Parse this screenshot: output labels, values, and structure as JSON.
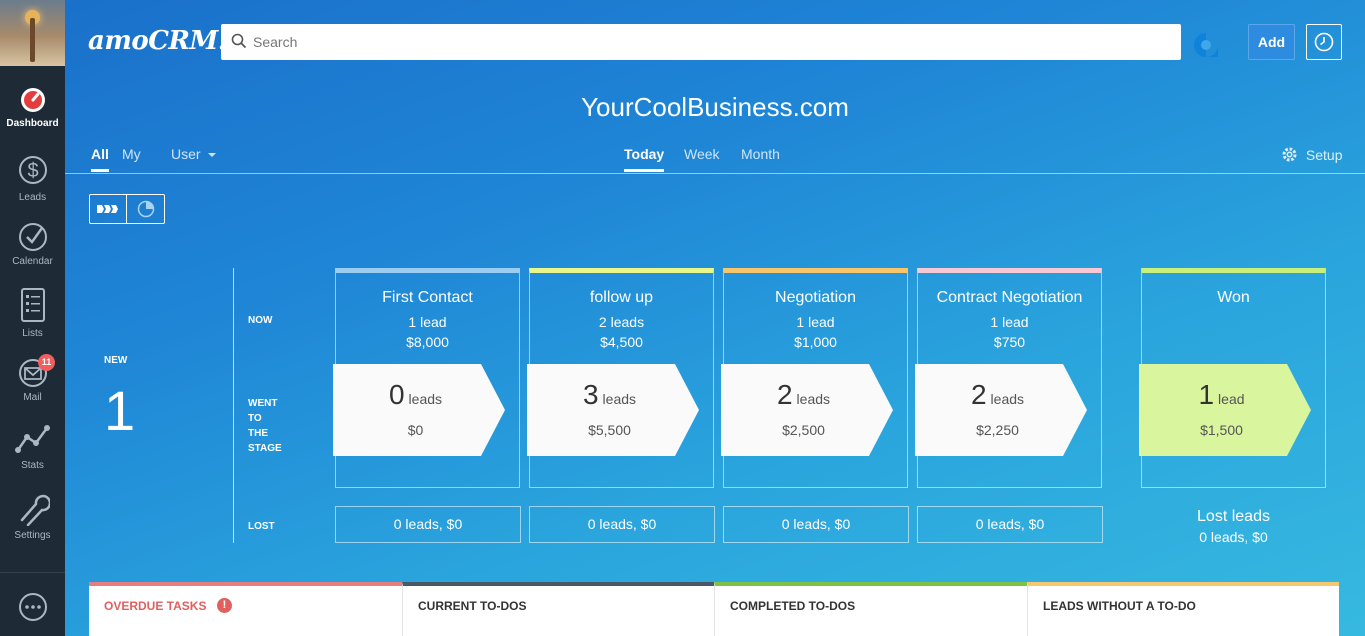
{
  "app": {
    "logo": "amoCRM.",
    "title": "YourCoolBusiness.com"
  },
  "search": {
    "placeholder": "Search"
  },
  "topbar": {
    "add_label": "Add"
  },
  "sidebar": {
    "items": [
      {
        "label": "Dashboard",
        "icon": "dashboard-icon",
        "active": true
      },
      {
        "label": "Leads",
        "icon": "dollar-icon"
      },
      {
        "label": "Calendar",
        "icon": "checkmark-circle-icon"
      },
      {
        "label": "Lists",
        "icon": "list-icon"
      },
      {
        "label": "Mail",
        "icon": "mail-icon",
        "badge": "11"
      },
      {
        "label": "Stats",
        "icon": "stats-icon"
      },
      {
        "label": "Settings",
        "icon": "wrench-icon"
      }
    ]
  },
  "filters": {
    "all": "All",
    "my": "My",
    "user": "User",
    "today": "Today",
    "week": "Week",
    "month": "Month",
    "setup": "Setup"
  },
  "pipeline": {
    "labels": {
      "new": "NEW",
      "now": "NOW",
      "went": "WENT\nTO\nTHE\nSTAGE",
      "lost": "LOST"
    },
    "new_count": "1",
    "stages": [
      {
        "name": "First Contact",
        "now_count": "1 lead",
        "now_amount": "$8,000",
        "went_num": "0",
        "went_unit": "leads",
        "went_amount": "$0",
        "lost": "0 leads, $0",
        "color": "#9bcdf2"
      },
      {
        "name": "follow up",
        "now_count": "2 leads",
        "now_amount": "$4,500",
        "went_num": "3",
        "went_unit": "leads",
        "went_amount": "$5,500",
        "lost": "0 leads, $0",
        "color": "#e9f78a"
      },
      {
        "name": "Negotiation",
        "now_count": "1 lead",
        "now_amount": "$1,000",
        "went_num": "2",
        "went_unit": "leads",
        "went_amount": "$2,500",
        "lost": "0 leads, $0",
        "color": "#f7c56b"
      },
      {
        "name": "Contract Negotiation",
        "now_count": "1 lead",
        "now_amount": "$750",
        "went_num": "2",
        "went_unit": "leads",
        "went_amount": "$2,250",
        "lost": "0 leads, $0",
        "color": "#f7c9d4"
      },
      {
        "name": "Won",
        "now_count": "",
        "now_amount": "",
        "went_num": "1",
        "went_unit": "lead",
        "went_amount": "$1,500",
        "color": "#c8f07a"
      }
    ],
    "lost_leads": {
      "title": "Lost leads",
      "value": "0 leads, $0"
    }
  },
  "tasks": [
    {
      "label": "OVERDUE TASKS",
      "color": "#e57f7f",
      "alert": "!"
    },
    {
      "label": "CURRENT TO-DOS",
      "color": "#4a5866"
    },
    {
      "label": "COMPLETED TO-DOS",
      "color": "#7dc244"
    },
    {
      "label": "LEADS WITHOUT A TO-DO",
      "color": "#f5c770"
    }
  ]
}
